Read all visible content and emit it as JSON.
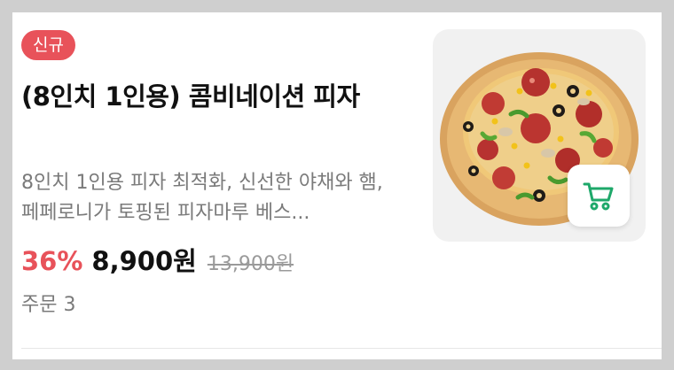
{
  "product": {
    "badge": "신규",
    "title": "(8인치 1인용) 콤비네이션 피자",
    "description": "8인치 1인용 피자 최적화, 신선한 야채와 햄, 페페로니가 토핑된 피자마루 베스...",
    "discount": "36%",
    "price": "8,900원",
    "original_price": "13,900원",
    "orders": "주문 3"
  },
  "icons": {
    "cart": "shopping-cart-icon"
  },
  "colors": {
    "accent": "#e8525a",
    "cart_icon": "#1ea86a"
  }
}
